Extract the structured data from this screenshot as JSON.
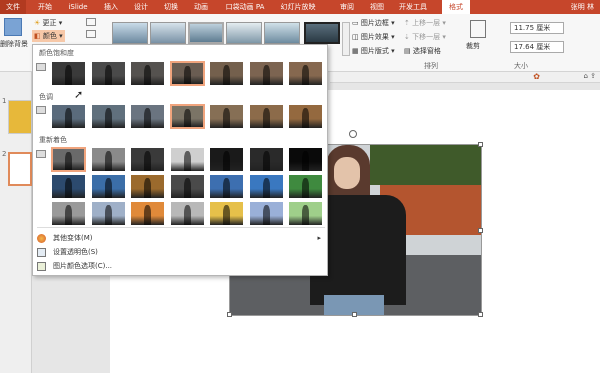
{
  "tabs": [
    {
      "label": "文件",
      "state": "file"
    },
    {
      "label": "开始",
      "state": "normal"
    },
    {
      "label": "iSlide",
      "state": "normal"
    },
    {
      "label": "插入",
      "state": "normal"
    },
    {
      "label": "设计",
      "state": "normal"
    },
    {
      "label": "切换",
      "state": "normal"
    },
    {
      "label": "动画",
      "state": "normal"
    },
    {
      "label": "口袋动画 PA",
      "state": "normal"
    },
    {
      "label": "幻灯片放映",
      "state": "normal"
    },
    {
      "label": "审阅",
      "state": "normal"
    },
    {
      "label": "视图",
      "state": "normal"
    },
    {
      "label": "开发工具",
      "state": "normal"
    },
    {
      "label": "格式",
      "state": "active"
    }
  ],
  "user": "张明 林",
  "ribbon": {
    "remove_bg": "删除背景",
    "corrections": "更正",
    "color": "颜色",
    "pic_border": "图片边框",
    "pic_effects": "图片效果",
    "pic_layout": "图片版式",
    "bring_forward": "上移一层",
    "send_backward": "下移一层",
    "selection_pane": "选择窗格",
    "crop": "裁剪",
    "height": "11.75 厘米",
    "width": "17.64 厘米",
    "group_arrange": "排列",
    "group_size": "大小"
  },
  "dropdown": {
    "sections": [
      {
        "title": "颜色饱和度"
      },
      {
        "title": "色调"
      },
      {
        "title": "重新着色"
      }
    ],
    "menu": [
      {
        "label": "其他变体(M)",
        "has_arrow": true
      },
      {
        "label": "设置透明色(S)",
        "has_arrow": false
      },
      {
        "label": "图片颜色选项(C)...",
        "has_arrow": false
      }
    ]
  },
  "thumbs": {
    "saturation": [
      "#3a3a3a",
      "#4a4a4a",
      "#55524f",
      "#6a5d52",
      "#74604d",
      "#7c6451",
      "#86684f"
    ],
    "tone": [
      "#5a6b7c",
      "#60707d",
      "#6a7480",
      "#7b7466",
      "#866f55",
      "#8c6b4a",
      "#94693f"
    ],
    "recolor_row1": [
      "#6a6a6a",
      "#8a8a8a",
      "#3a3a3a",
      "#cfcfcf",
      "#1a1a1a",
      "#2a2a2a",
      "#0a0a0a"
    ],
    "recolor_row2": [
      "#2c4a6e",
      "#3b6ea8",
      "#9b6a2d",
      "#4a4a4a",
      "#3d6fb0",
      "#3a78c0",
      "#3f8a3f"
    ],
    "recolor_row3": [
      "#9a9a9a",
      "#9fb0c8",
      "#e08a3a",
      "#b8b8b8",
      "#e6c04a",
      "#9ab0d8",
      "#9fcf8a"
    ]
  },
  "selected": {
    "saturation": 3,
    "tone": 3,
    "recolor": 0
  }
}
